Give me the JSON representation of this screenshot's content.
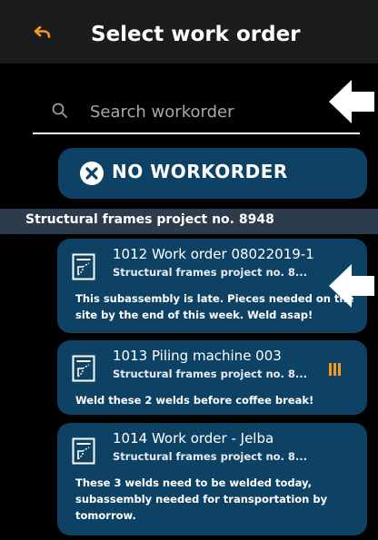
{
  "header": {
    "title": "Select work order"
  },
  "search": {
    "placeholder": "Search workorder"
  },
  "no_workorder": {
    "label": "NO WORKORDER"
  },
  "group": {
    "label": "Structural frames project no. 8948"
  },
  "orders": [
    {
      "title": "1012 Work order 08022019-1",
      "subtitle": "Structural frames project no. 8...",
      "description": "This subassembly is late. Pieces needed on the site by the end of this week. Weld asap!"
    },
    {
      "title": "1013 Piling machine 003",
      "subtitle": "Structural frames project no. 8...",
      "description": "Weld these 2 welds before coffee break!",
      "status_icon": "pause-icon"
    },
    {
      "title": "1014 Work order  - Jelba",
      "subtitle": "Structural frames project no. 8...",
      "description": "These 3 welds need to be welded today, subassembly needed for transportation by tomorrow."
    }
  ],
  "icons": {
    "back": "back-arrow-icon",
    "search": "search-icon",
    "no_workorder": "close-circle-icon",
    "order": "document-icon",
    "annotation": "white-arrow-icon"
  },
  "colors": {
    "background": "#000000",
    "header": "#1c1c1e",
    "card": "#0e4264",
    "group_header": "#2d3c4c",
    "accent_orange": "#f39a1f"
  }
}
